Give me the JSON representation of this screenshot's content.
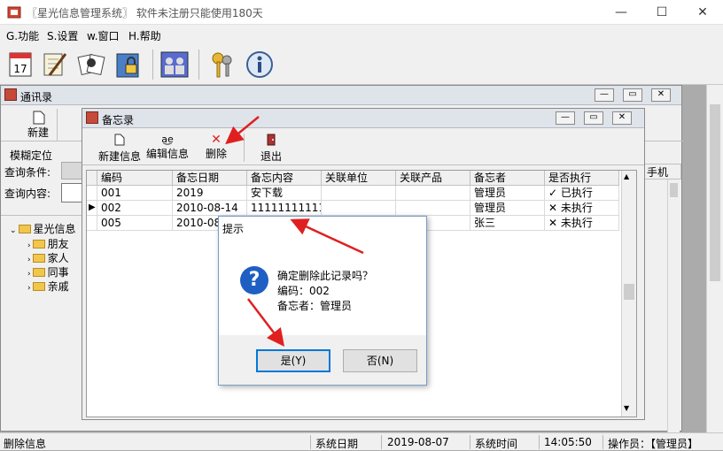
{
  "window": {
    "title": "〖星光信息管理系统〗 软件未注册只能使用180天"
  },
  "menu": [
    {
      "label": "G.功能"
    },
    {
      "label": "S.设置"
    },
    {
      "label": "w.窗口"
    },
    {
      "label": "H.帮助"
    }
  ],
  "contacts": {
    "title": "通讯录",
    "new_label": "新建",
    "fuzzy_label": "模糊定位",
    "cond_label": "查询条件:",
    "content_label": "查询内容:",
    "tree_root": "星光信息",
    "tree_items": [
      "朋友",
      "家人",
      "同事",
      "亲戚"
    ],
    "right_header": "手机"
  },
  "memo": {
    "title": "备忘录",
    "toolbar": {
      "new": "新建信息",
      "edit": "编辑信息",
      "delete": "删除",
      "exit": "退出"
    },
    "columns": [
      "编码",
      "备忘日期",
      "备忘内容",
      "关联单位",
      "关联产品",
      "备忘者",
      "是否执行"
    ],
    "rows": [
      {
        "code": "001",
        "date": "2019",
        "content": "安下载",
        "unit": "",
        "product": "",
        "by": "管理员",
        "done": "✓ 已执行"
      },
      {
        "code": "002",
        "date": "2010-08-14",
        "content": "1111111111111",
        "unit": "",
        "product": "",
        "by": "管理员",
        "done": "✕ 未执行"
      },
      {
        "code": "005",
        "date": "2010-08",
        "content": "",
        "unit": "",
        "product": "",
        "by": "张三",
        "done": "✕ 未执行"
      }
    ]
  },
  "dialog": {
    "title": "提示",
    "line1": "确定删除此记录吗？",
    "line2": "编码：002",
    "line3": "备忘者：管理员",
    "yes": "是(Y)",
    "no": "否(N)"
  },
  "status": {
    "left": "删除信息",
    "date_label": "系统日期",
    "date": "2019-08-07",
    "time_label": "系统时间",
    "time": "14:05:50",
    "operator": "操作员：【管理员】"
  },
  "colors": {
    "arrow": "#e02020",
    "selection": "#0078d7"
  }
}
